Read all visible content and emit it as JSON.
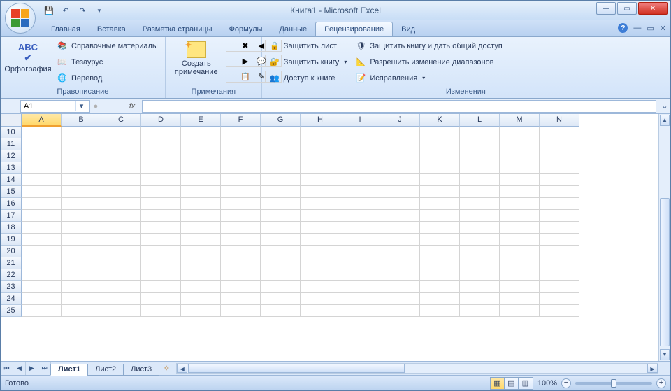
{
  "title": "Книга1 - Microsoft Excel",
  "tabs": [
    "Главная",
    "Вставка",
    "Разметка страницы",
    "Формулы",
    "Данные",
    "Рецензирование",
    "Вид"
  ],
  "active_tab": 5,
  "ribbon": {
    "group1": {
      "label": "Правописание",
      "spelling": "Орфография",
      "items": [
        "Справочные материалы",
        "Тезаурус",
        "Перевод"
      ]
    },
    "group2": {
      "label": "Примечания",
      "new": "Создать примечание"
    },
    "group3": {
      "label": "Изменения",
      "col1": [
        "Защитить лист",
        "Защитить книгу",
        "Доступ к книге"
      ],
      "col2": [
        "Защитить книгу и дать общий доступ",
        "Разрешить изменение диапазонов",
        "Исправления"
      ]
    }
  },
  "namebox": "A1",
  "columns": [
    "A",
    "B",
    "C",
    "D",
    "E",
    "F",
    "G",
    "H",
    "I",
    "J",
    "K",
    "L",
    "M",
    "N"
  ],
  "rows": [
    10,
    11,
    12,
    13,
    14,
    15,
    16,
    17,
    18,
    19,
    20,
    21,
    22,
    23,
    24,
    25
  ],
  "sheets": [
    "Лист1",
    "Лист2",
    "Лист3"
  ],
  "active_sheet": 0,
  "status": "Готово",
  "zoom": "100%"
}
